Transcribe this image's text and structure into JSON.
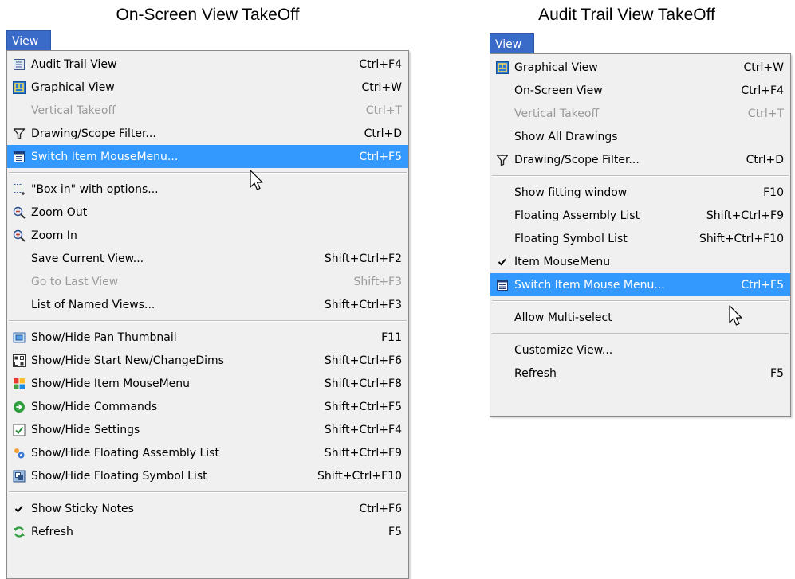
{
  "left_panel": {
    "caption": "On-Screen View TakeOff",
    "menu_tab": "View",
    "items": [
      {
        "label": "Audit Trail View",
        "shortcut": "Ctrl+F4",
        "icon": "audit-trail-icon"
      },
      {
        "label": "Graphical View",
        "shortcut": "Ctrl+W",
        "icon": "graphical-view-icon"
      },
      {
        "label": "Vertical Takeoff",
        "shortcut": "Ctrl+T",
        "icon": "",
        "disabled": true
      },
      {
        "label": "Drawing/Scope Filter...",
        "shortcut": "Ctrl+D",
        "icon": "filter-icon"
      },
      {
        "label": "Switch Item MouseMenu...",
        "shortcut": "Ctrl+F5",
        "icon": "mousemenu-icon",
        "highlighted": true
      },
      {
        "label": "\"Box in\" with options...",
        "shortcut": "",
        "icon": "box-in-icon"
      },
      {
        "label": "Zoom Out",
        "shortcut": "",
        "icon": "zoom-out-icon"
      },
      {
        "label": "Zoom In",
        "shortcut": "",
        "icon": "zoom-in-icon"
      },
      {
        "label": "Save Current View...",
        "shortcut": "Shift+Ctrl+F2",
        "icon": ""
      },
      {
        "label": "Go to Last View",
        "shortcut": "Shift+F3",
        "icon": "",
        "disabled": true
      },
      {
        "label": "List of Named Views...",
        "shortcut": "Shift+Ctrl+F3",
        "icon": ""
      },
      {
        "label": "Show/Hide Pan Thumbnail",
        "shortcut": "F11",
        "icon": "pan-thumbnail-icon"
      },
      {
        "label": "Show/Hide Start New/ChangeDims",
        "shortcut": "Shift+Ctrl+F6",
        "icon": "start-new-icon"
      },
      {
        "label": "Show/Hide Item MouseMenu",
        "shortcut": "Shift+Ctrl+F8",
        "icon": "item-mousemenu-grid-icon"
      },
      {
        "label": "Show/Hide Commands",
        "shortcut": "Shift+Ctrl+F5",
        "icon": "commands-icon"
      },
      {
        "label": "Show/Hide Settings",
        "shortcut": "Shift+Ctrl+F4",
        "icon": "settings-check-icon"
      },
      {
        "label": "Show/Hide Floating Assembly List",
        "shortcut": "Shift+Ctrl+F9",
        "icon": "assembly-list-icon"
      },
      {
        "label": "Show/Hide Floating Symbol List",
        "shortcut": "Shift+Ctrl+F10",
        "icon": "symbol-list-icon"
      },
      {
        "label": "Show Sticky Notes",
        "shortcut": "Ctrl+F6",
        "icon": "checkmark-icon"
      },
      {
        "label": "Refresh",
        "shortcut": "F5",
        "icon": "refresh-icon"
      }
    ]
  },
  "right_panel": {
    "caption": "Audit Trail View TakeOff",
    "menu_tab": "View",
    "items": [
      {
        "label": "Graphical View",
        "shortcut": "Ctrl+W",
        "icon": "graphical-view-icon"
      },
      {
        "label": "On-Screen View",
        "shortcut": "Ctrl+F4",
        "icon": ""
      },
      {
        "label": "Vertical Takeoff",
        "shortcut": "Ctrl+T",
        "icon": "",
        "disabled": true
      },
      {
        "label": "Show All Drawings",
        "shortcut": "",
        "icon": ""
      },
      {
        "label": "Drawing/Scope Filter...",
        "shortcut": "Ctrl+D",
        "icon": "filter-icon"
      },
      {
        "label": "Show fitting window",
        "shortcut": "F10",
        "icon": ""
      },
      {
        "label": "Floating Assembly List",
        "shortcut": "Shift+Ctrl+F9",
        "icon": ""
      },
      {
        "label": "Floating Symbol List",
        "shortcut": "Shift+Ctrl+F10",
        "icon": ""
      },
      {
        "label": "Item MouseMenu",
        "shortcut": "",
        "icon": "checkmark-icon"
      },
      {
        "label": "Switch Item Mouse Menu...",
        "shortcut": "Ctrl+F5",
        "icon": "mousemenu-icon",
        "highlighted": true
      },
      {
        "label": "Allow Multi-select",
        "shortcut": "",
        "icon": ""
      },
      {
        "label": "Customize View...",
        "shortcut": "",
        "icon": ""
      },
      {
        "label": "Refresh",
        "shortcut": "F5",
        "icon": ""
      }
    ]
  },
  "colors": {
    "highlight": "#3399ff",
    "menu_tab": "#3a6bc8",
    "menu_background": "#f0f0f0",
    "disabled_text": "#9a9a9a"
  }
}
